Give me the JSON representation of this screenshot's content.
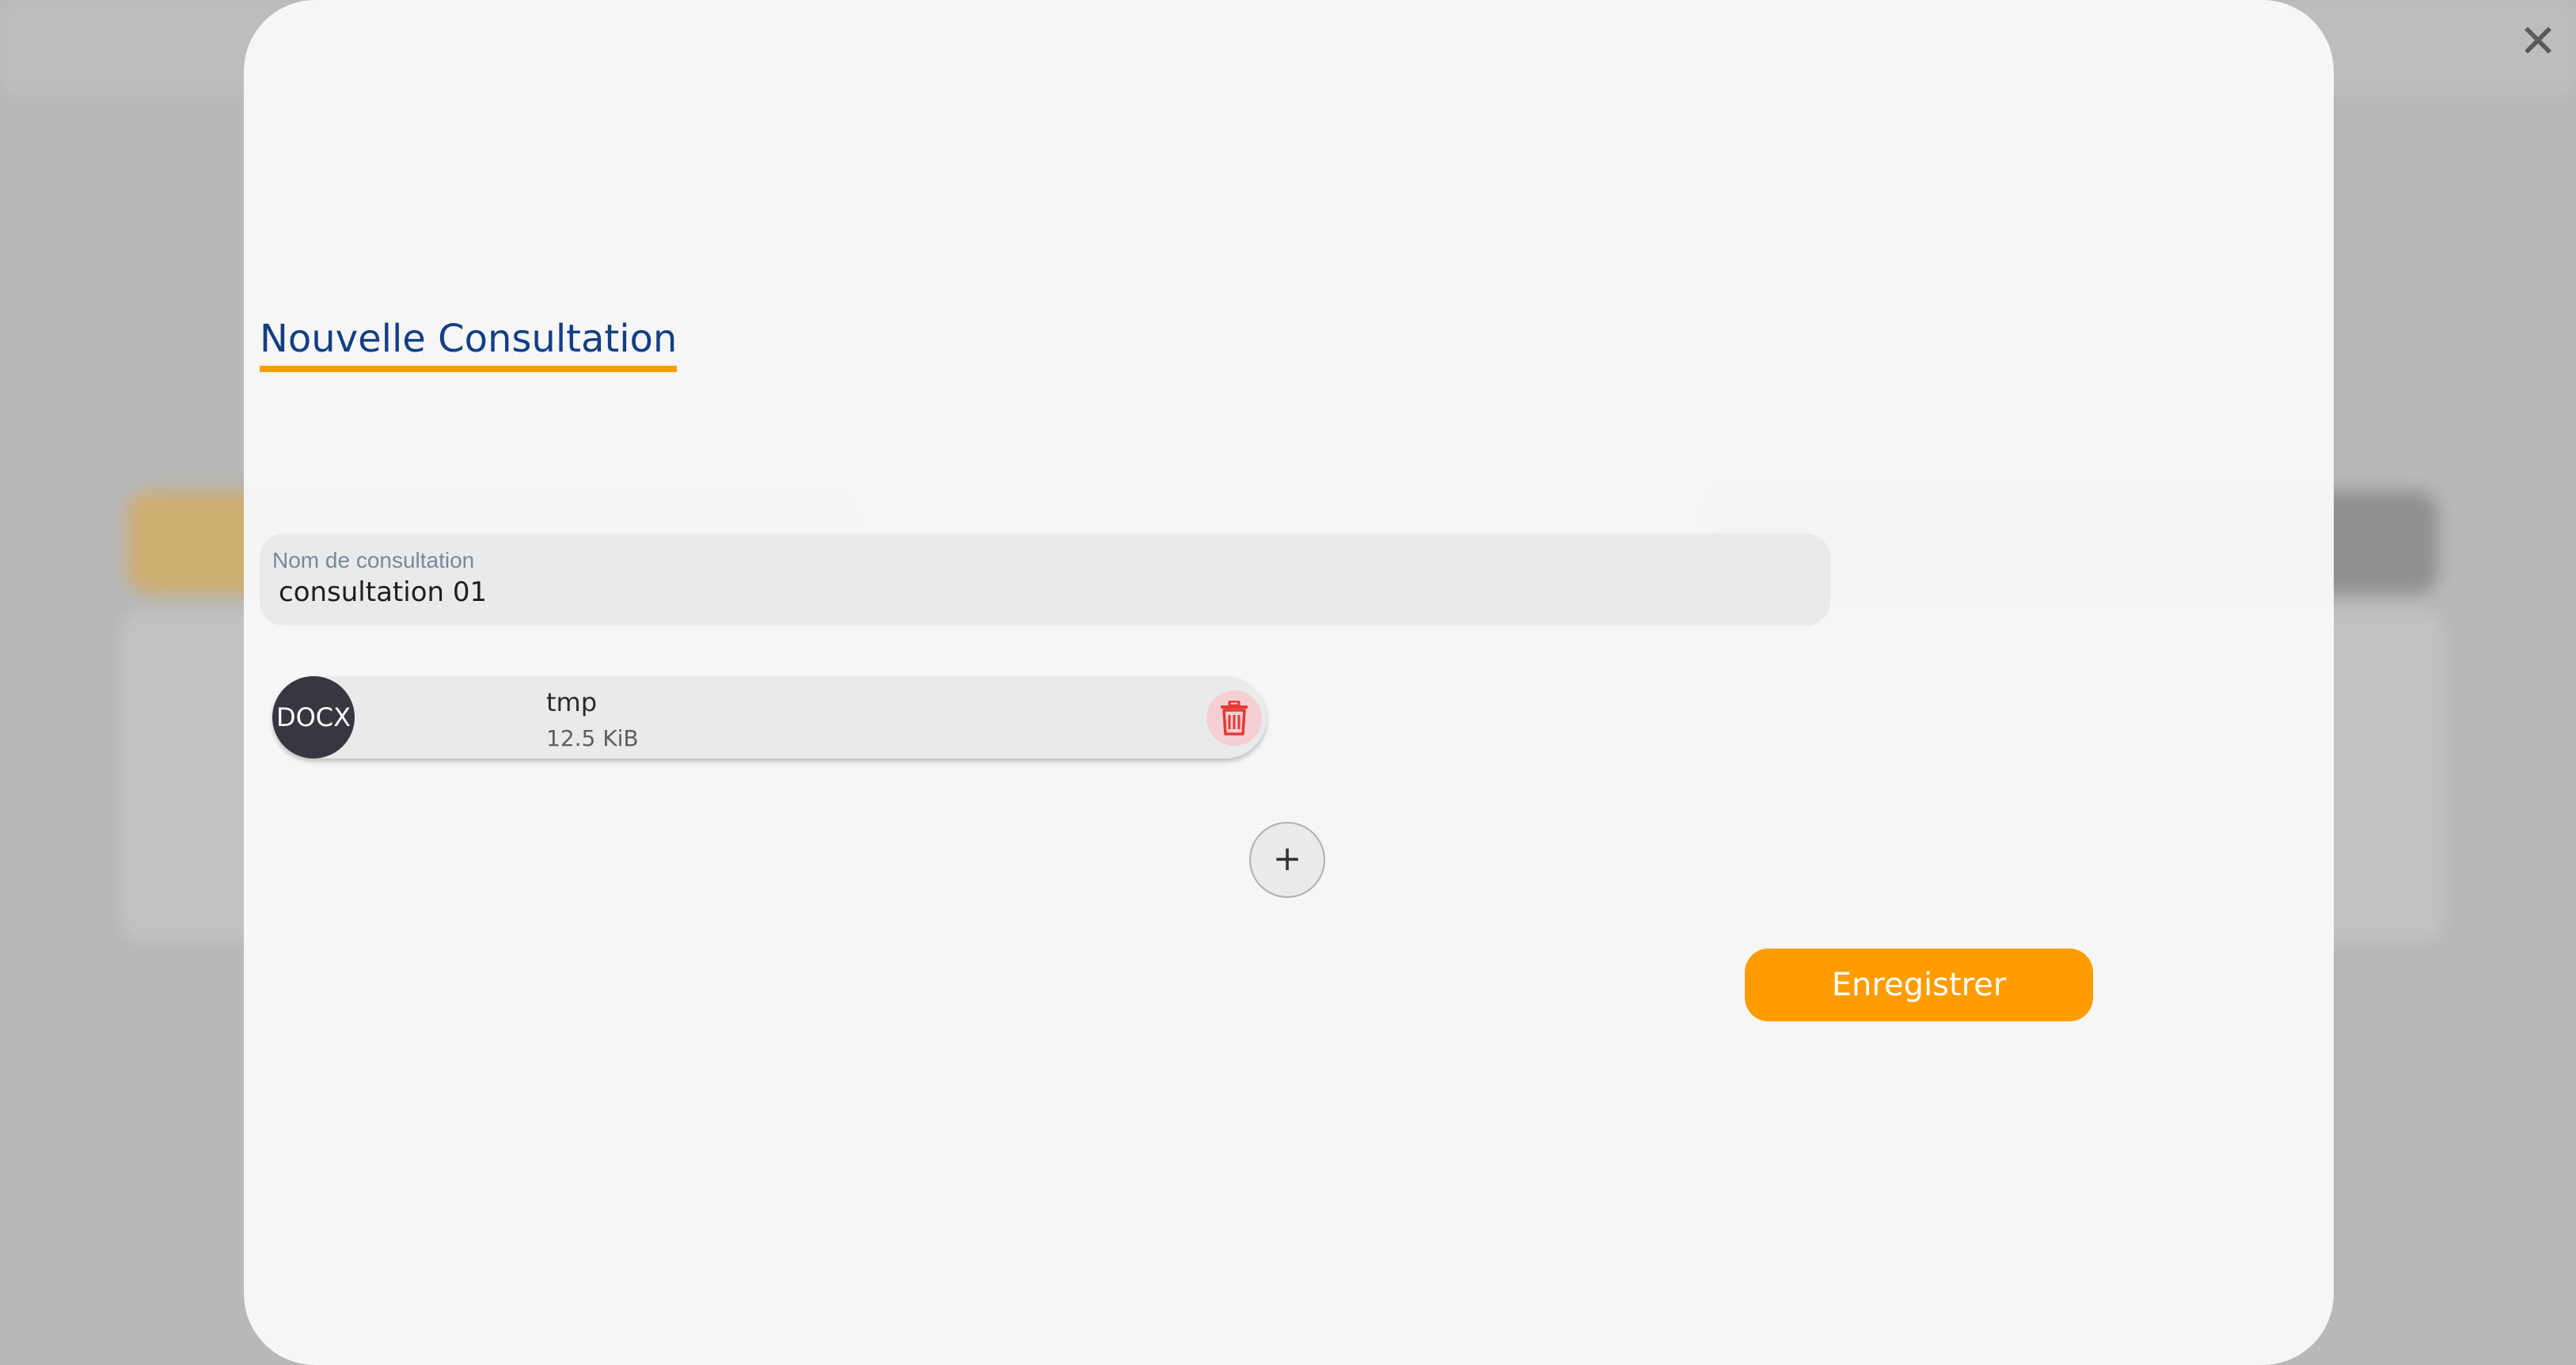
{
  "modal": {
    "title": "Nouvelle Consultation",
    "close_icon": "close-icon"
  },
  "form": {
    "name_label": "Nom de consultation",
    "name_value": "consultation 01"
  },
  "file": {
    "type_badge": "DOCX",
    "name": "tmp",
    "size": "12.5 KiB",
    "delete_icon": "trash-icon"
  },
  "actions": {
    "add_symbol": "+",
    "save_label": "Enregistrer"
  },
  "colors": {
    "accent": "#ff9c00",
    "title": "#123f83",
    "badge": "#363740",
    "danger": "#e53935"
  }
}
